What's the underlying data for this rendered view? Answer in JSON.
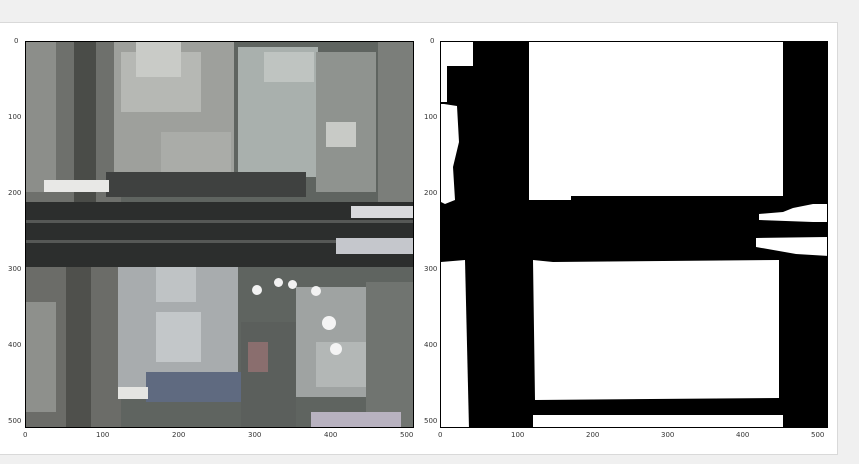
{
  "left_panel": {
    "content": "aerial-photo",
    "x_ticks": [
      "0",
      "100",
      "200",
      "300",
      "400",
      "500"
    ],
    "y_ticks": [
      "0",
      "100",
      "200",
      "300",
      "400",
      "500"
    ]
  },
  "right_panel": {
    "content": "binary-mask",
    "x_ticks": [
      "0",
      "100",
      "200",
      "300",
      "400",
      "500"
    ],
    "y_ticks": [
      "0",
      "100",
      "200",
      "300",
      "400",
      "500"
    ]
  },
  "colors": {
    "figure_bg": "#ffffff",
    "page_bg": "#f0f0f0",
    "mask_foreground": "#ffffff",
    "mask_background": "#000000"
  }
}
